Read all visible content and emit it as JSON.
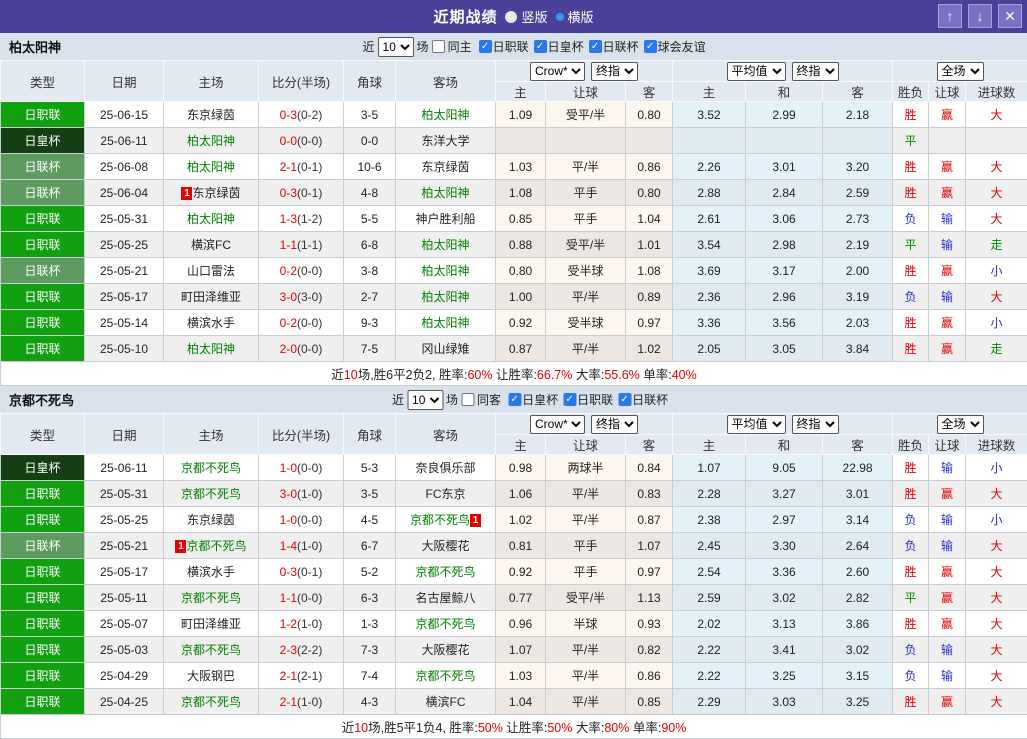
{
  "titlebar": {
    "title": "近期战绩",
    "radio_vertical": "竖版",
    "radio_horizontal": "横版",
    "selected_layout": "横版"
  },
  "icons": {
    "up": "↑",
    "down": "↓",
    "close": "✕",
    "check": "✓"
  },
  "columns": {
    "type": "类型",
    "date": "日期",
    "home": "主场",
    "score": "比分(半场)",
    "corner": "角球",
    "away": "客场",
    "crow_home": "主",
    "crow_handicap": "让球",
    "crow_away": "客",
    "avg_home": "主",
    "avg_draw": "和",
    "avg_away": "客",
    "wdl": "胜负",
    "handicap_result": "让球",
    "goals": "进球数"
  },
  "controls": {
    "crow": "Crow*",
    "final": "终指",
    "avg": "平均值",
    "full": "全场"
  },
  "league_colors": {
    "日职联": "#10a010",
    "日皇杯": "#153e15",
    "日联杯": "#5e9b60"
  },
  "outcome_colors": {
    "胜": "#e10000",
    "赢": "#e10000",
    "大": "#e10000",
    "平": "#008800",
    "走": "#008800",
    "负": "#2a2ad0",
    "输": "#2a2ad0",
    "小": "#2a2ad0"
  },
  "sections": [
    {
      "team": "柏太阳神",
      "filter": {
        "prefix": "近",
        "count": "10",
        "suffix": "场",
        "same": "同主",
        "leagues": [
          "日职联",
          "日皇杯",
          "日联杯",
          "球会友谊"
        ]
      },
      "rows": [
        {
          "lg": "日职联",
          "date": "25-06-15",
          "home": "东京绿茵",
          "homeT": false,
          "homeB": "",
          "sc": "0-3",
          "hf": "(0-2)",
          "cn": "3-5",
          "away": "柏太阳神",
          "awayT": true,
          "awayB": "",
          "o1": "1.09",
          "o2": "受平/半",
          "o3": "0.80",
          "a1": "3.52",
          "a2": "2.99",
          "a3": "2.18",
          "r1": "胜",
          "r2": "赢",
          "r3": "大"
        },
        {
          "lg": "日皇杯",
          "date": "25-06-11",
          "home": "柏太阳神",
          "homeT": true,
          "homeB": "",
          "sc": "0-0",
          "hf": "(0-0)",
          "cn": "0-0",
          "away": "东洋大学",
          "awayT": false,
          "awayB": "",
          "o1": "",
          "o2": "",
          "o3": "",
          "a1": "",
          "a2": "",
          "a3": "",
          "r1": "平",
          "r2": "",
          "r3": ""
        },
        {
          "lg": "日联杯",
          "date": "25-06-08",
          "home": "柏太阳神",
          "homeT": true,
          "homeB": "",
          "sc": "2-1",
          "hf": "(0-1)",
          "cn": "10-6",
          "away": "东京绿茵",
          "awayT": false,
          "awayB": "",
          "o1": "1.03",
          "o2": "平/半",
          "o3": "0.86",
          "a1": "2.26",
          "a2": "3.01",
          "a3": "3.20",
          "r1": "胜",
          "r2": "赢",
          "r3": "大"
        },
        {
          "lg": "日联杯",
          "date": "25-06-04",
          "home": "东京绿茵",
          "homeT": false,
          "homeB": "1",
          "sc": "0-3",
          "hf": "(0-1)",
          "cn": "4-8",
          "away": "柏太阳神",
          "awayT": true,
          "awayB": "",
          "o1": "1.08",
          "o2": "平手",
          "o3": "0.80",
          "a1": "2.88",
          "a2": "2.84",
          "a3": "2.59",
          "r1": "胜",
          "r2": "赢",
          "r3": "大"
        },
        {
          "lg": "日职联",
          "date": "25-05-31",
          "home": "柏太阳神",
          "homeT": true,
          "homeB": "",
          "sc": "1-3",
          "hf": "(1-2)",
          "cn": "5-5",
          "away": "神户胜利船",
          "awayT": false,
          "awayB": "",
          "o1": "0.85",
          "o2": "平手",
          "o3": "1.04",
          "a1": "2.61",
          "a2": "3.06",
          "a3": "2.73",
          "r1": "负",
          "r2": "输",
          "r3": "大"
        },
        {
          "lg": "日职联",
          "date": "25-05-25",
          "home": "横滨FC",
          "homeT": false,
          "homeB": "",
          "sc": "1-1",
          "hf": "(1-1)",
          "cn": "6-8",
          "away": "柏太阳神",
          "awayT": true,
          "awayB": "",
          "o1": "0.88",
          "o2": "受平/半",
          "o3": "1.01",
          "a1": "3.54",
          "a2": "2.98",
          "a3": "2.19",
          "r1": "平",
          "r2": "输",
          "r3": "走"
        },
        {
          "lg": "日联杯",
          "date": "25-05-21",
          "home": "山口雷法",
          "homeT": false,
          "homeB": "",
          "sc": "0-2",
          "hf": "(0-0)",
          "cn": "3-8",
          "away": "柏太阳神",
          "awayT": true,
          "awayB": "",
          "o1": "0.80",
          "o2": "受半球",
          "o3": "1.08",
          "a1": "3.69",
          "a2": "3.17",
          "a3": "2.00",
          "r1": "胜",
          "r2": "赢",
          "r3": "小"
        },
        {
          "lg": "日职联",
          "date": "25-05-17",
          "home": "町田泽维亚",
          "homeT": false,
          "homeB": "",
          "sc": "3-0",
          "hf": "(3-0)",
          "cn": "2-7",
          "away": "柏太阳神",
          "awayT": true,
          "awayB": "",
          "o1": "1.00",
          "o2": "平/半",
          "o3": "0.89",
          "a1": "2.36",
          "a2": "2.96",
          "a3": "3.19",
          "r1": "负",
          "r2": "输",
          "r3": "大"
        },
        {
          "lg": "日职联",
          "date": "25-05-14",
          "home": "横滨水手",
          "homeT": false,
          "homeB": "",
          "sc": "0-2",
          "hf": "(0-0)",
          "cn": "9-3",
          "away": "柏太阳神",
          "awayT": true,
          "awayB": "",
          "o1": "0.92",
          "o2": "受半球",
          "o3": "0.97",
          "a1": "3.36",
          "a2": "3.56",
          "a3": "2.03",
          "r1": "胜",
          "r2": "赢",
          "r3": "小"
        },
        {
          "lg": "日职联",
          "date": "25-05-10",
          "home": "柏太阳神",
          "homeT": true,
          "homeB": "",
          "sc": "2-0",
          "hf": "(0-0)",
          "cn": "7-5",
          "away": "冈山绿雉",
          "awayT": false,
          "awayB": "",
          "o1": "0.87",
          "o2": "平/半",
          "o3": "1.02",
          "a1": "2.05",
          "a2": "3.05",
          "a3": "3.84",
          "r1": "胜",
          "r2": "赢",
          "r3": "走"
        }
      ],
      "summary": [
        {
          "t": "近"
        },
        {
          "t": "10",
          "red": true
        },
        {
          "t": "场,胜6平2负2, 胜率:"
        },
        {
          "t": "60%",
          "red": true
        },
        {
          "t": " 让胜率:"
        },
        {
          "t": "66.7%",
          "red": true
        },
        {
          "t": " 大率:"
        },
        {
          "t": "55.6%",
          "red": true
        },
        {
          "t": " 单率:"
        },
        {
          "t": "40%",
          "red": true
        }
      ]
    },
    {
      "team": "京都不死鸟",
      "filter": {
        "prefix": "近",
        "count": "10",
        "suffix": "场",
        "same": "同客",
        "leagues": [
          "日皇杯",
          "日职联",
          "日联杯"
        ]
      },
      "rows": [
        {
          "lg": "日皇杯",
          "date": "25-06-11",
          "home": "京都不死鸟",
          "homeT": true,
          "homeB": "",
          "sc": "1-0",
          "hf": "(0-0)",
          "cn": "5-3",
          "away": "奈良俱乐部",
          "awayT": false,
          "awayB": "",
          "o1": "0.98",
          "o2": "两球半",
          "o3": "0.84",
          "a1": "1.07",
          "a2": "9.05",
          "a3": "22.98",
          "r1": "胜",
          "r2": "输",
          "r3": "小"
        },
        {
          "lg": "日职联",
          "date": "25-05-31",
          "home": "京都不死鸟",
          "homeT": true,
          "homeB": "",
          "sc": "3-0",
          "hf": "(1-0)",
          "cn": "3-5",
          "away": "FC东京",
          "awayT": false,
          "awayB": "",
          "o1": "1.06",
          "o2": "平/半",
          "o3": "0.83",
          "a1": "2.28",
          "a2": "3.27",
          "a3": "3.01",
          "r1": "胜",
          "r2": "赢",
          "r3": "大"
        },
        {
          "lg": "日职联",
          "date": "25-05-25",
          "home": "东京绿茵",
          "homeT": false,
          "homeB": "",
          "sc": "1-0",
          "hf": "(0-0)",
          "cn": "4-5",
          "away": "京都不死鸟",
          "awayT": true,
          "awayB": "1",
          "o1": "1.02",
          "o2": "平/半",
          "o3": "0.87",
          "a1": "2.38",
          "a2": "2.97",
          "a3": "3.14",
          "r1": "负",
          "r2": "输",
          "r3": "小"
        },
        {
          "lg": "日联杯",
          "date": "25-05-21",
          "home": "京都不死鸟",
          "homeT": true,
          "homeB": "1",
          "sc": "1-4",
          "hf": "(1-0)",
          "cn": "6-7",
          "away": "大阪樱花",
          "awayT": false,
          "awayB": "",
          "o1": "0.81",
          "o2": "平手",
          "o3": "1.07",
          "a1": "2.45",
          "a2": "3.30",
          "a3": "2.64",
          "r1": "负",
          "r2": "输",
          "r3": "大"
        },
        {
          "lg": "日职联",
          "date": "25-05-17",
          "home": "横滨水手",
          "homeT": false,
          "homeB": "",
          "sc": "0-3",
          "hf": "(0-1)",
          "cn": "5-2",
          "away": "京都不死鸟",
          "awayT": true,
          "awayB": "",
          "o1": "0.92",
          "o2": "平手",
          "o3": "0.97",
          "a1": "2.54",
          "a2": "3.36",
          "a3": "2.60",
          "r1": "胜",
          "r2": "赢",
          "r3": "大"
        },
        {
          "lg": "日职联",
          "date": "25-05-11",
          "home": "京都不死鸟",
          "homeT": true,
          "homeB": "",
          "sc": "1-1",
          "hf": "(0-0)",
          "cn": "6-3",
          "away": "名古屋鲸八",
          "awayT": false,
          "awayB": "",
          "o1": "0.77",
          "o2": "受平/半",
          "o3": "1.13",
          "a1": "2.59",
          "a2": "3.02",
          "a3": "2.82",
          "r1": "平",
          "r2": "赢",
          "r3": "大"
        },
        {
          "lg": "日职联",
          "date": "25-05-07",
          "home": "町田泽维亚",
          "homeT": false,
          "homeB": "",
          "sc": "1-2",
          "hf": "(1-0)",
          "cn": "1-3",
          "away": "京都不死鸟",
          "awayT": true,
          "awayB": "",
          "o1": "0.96",
          "o2": "半球",
          "o3": "0.93",
          "a1": "2.02",
          "a2": "3.13",
          "a3": "3.86",
          "r1": "胜",
          "r2": "赢",
          "r3": "大"
        },
        {
          "lg": "日职联",
          "date": "25-05-03",
          "home": "京都不死鸟",
          "homeT": true,
          "homeB": "",
          "sc": "2-3",
          "hf": "(2-2)",
          "cn": "7-3",
          "away": "大阪樱花",
          "awayT": false,
          "awayB": "",
          "o1": "1.07",
          "o2": "平/半",
          "o3": "0.82",
          "a1": "2.22",
          "a2": "3.41",
          "a3": "3.02",
          "r1": "负",
          "r2": "输",
          "r3": "大"
        },
        {
          "lg": "日职联",
          "date": "25-04-29",
          "home": "大阪钢巴",
          "homeT": false,
          "homeB": "",
          "sc": "2-1",
          "hf": "(2-1)",
          "cn": "7-4",
          "away": "京都不死鸟",
          "awayT": true,
          "awayB": "",
          "o1": "1.03",
          "o2": "平/半",
          "o3": "0.86",
          "a1": "2.22",
          "a2": "3.25",
          "a3": "3.15",
          "r1": "负",
          "r2": "输",
          "r3": "大"
        },
        {
          "lg": "日职联",
          "date": "25-04-25",
          "home": "京都不死鸟",
          "homeT": true,
          "homeB": "",
          "sc": "2-1",
          "hf": "(1-0)",
          "cn": "4-3",
          "away": "横滨FC",
          "awayT": false,
          "awayB": "",
          "o1": "1.04",
          "o2": "平/半",
          "o3": "0.85",
          "a1": "2.29",
          "a2": "3.03",
          "a3": "3.25",
          "r1": "胜",
          "r2": "赢",
          "r3": "大"
        }
      ],
      "summary": [
        {
          "t": "近"
        },
        {
          "t": "10",
          "red": true
        },
        {
          "t": "场,胜5平1负4, 胜率:"
        },
        {
          "t": "50%",
          "red": true
        },
        {
          "t": " 让胜率:"
        },
        {
          "t": "50%",
          "red": true
        },
        {
          "t": " 大率:"
        },
        {
          "t": "80%",
          "red": true
        },
        {
          "t": " 单率:"
        },
        {
          "t": "90%",
          "red": true
        }
      ]
    }
  ]
}
